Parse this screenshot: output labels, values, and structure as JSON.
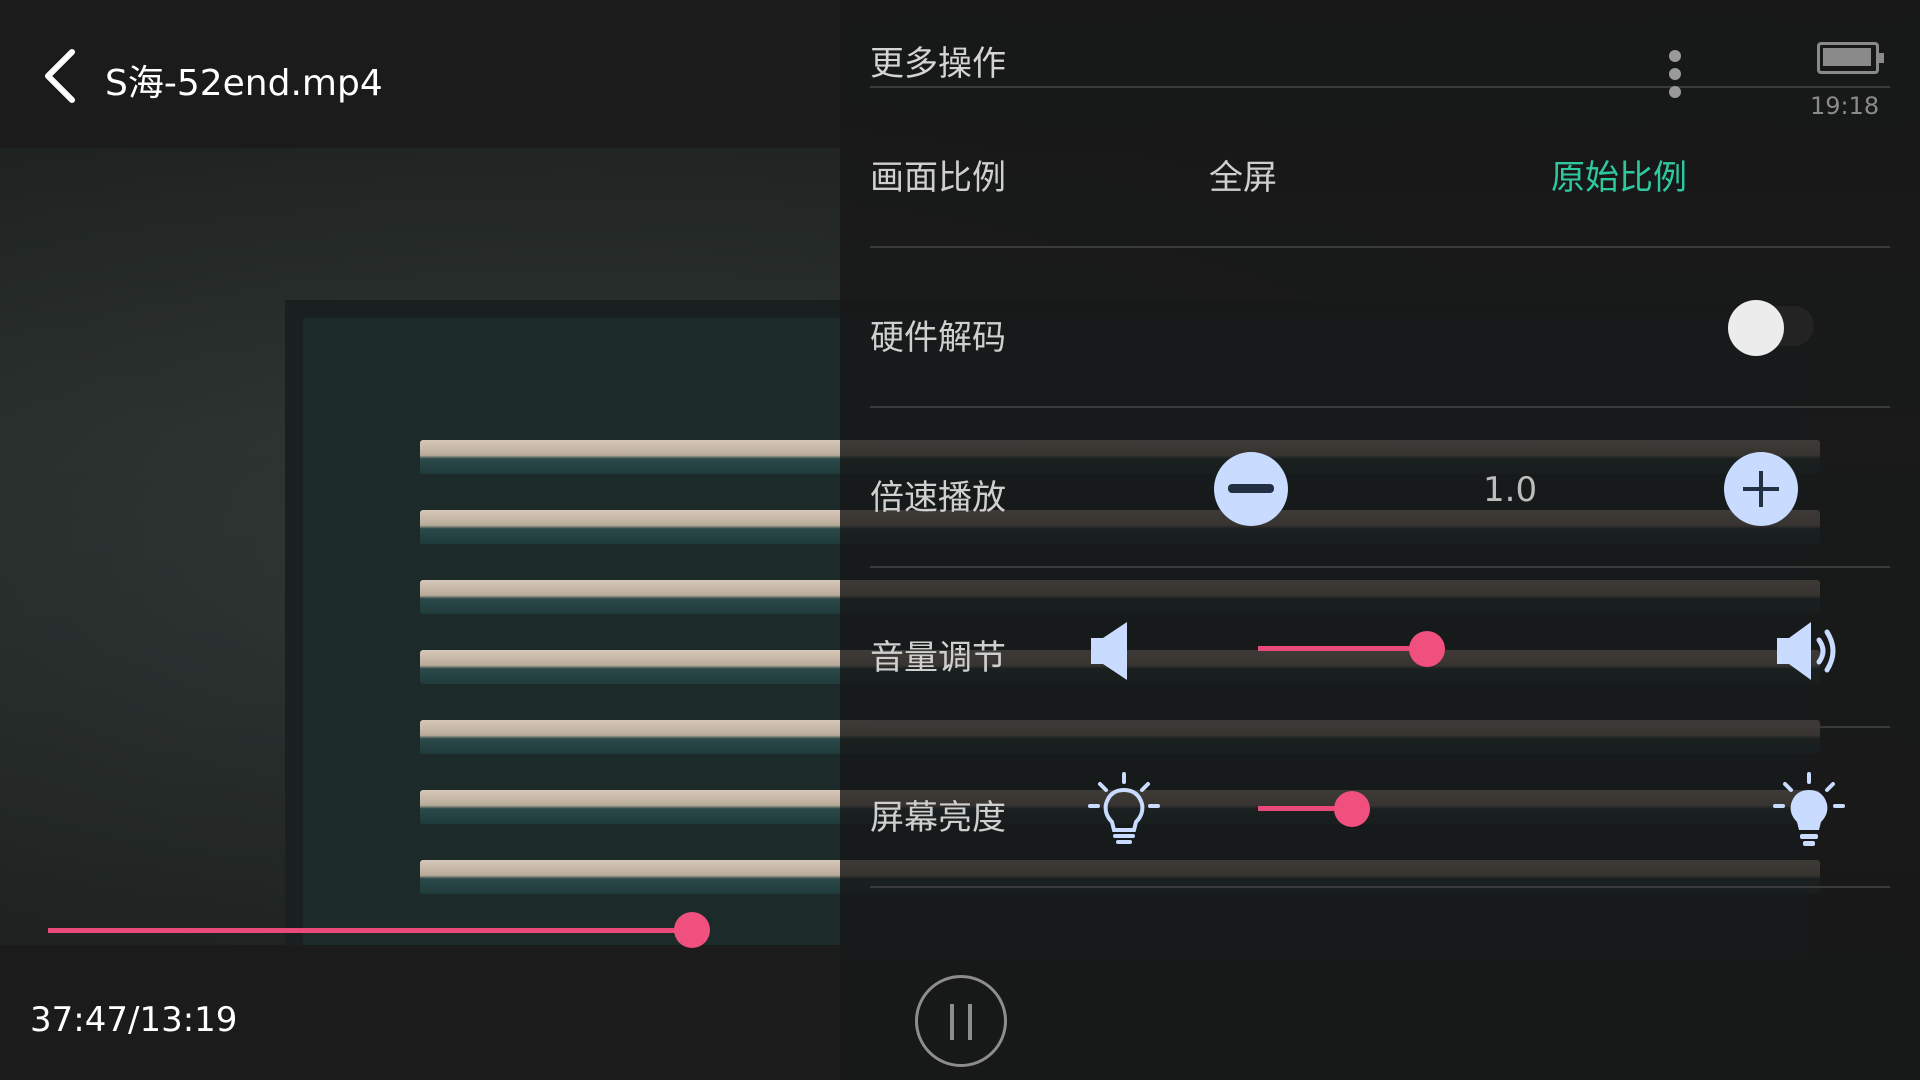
{
  "player": {
    "title": "S海-52end.mp4",
    "time": "37:47/13:19",
    "progress_fraction": 0.82,
    "state": "playing"
  },
  "panel": {
    "title": "更多操作",
    "clock": "19:18",
    "aspect": {
      "label": "画面比例",
      "options": [
        "全屏",
        "原始比例"
      ],
      "selected": "原始比例"
    },
    "hw_decode": {
      "label": "硬件解码",
      "enabled": false
    },
    "speed": {
      "label": "倍速播放",
      "value": "1.0"
    },
    "volume": {
      "label": "音量调节",
      "level_fraction": 0.36
    },
    "brightness": {
      "label": "屏幕亮度",
      "level_fraction": 0.2
    }
  },
  "colors": {
    "accent": "#F0507E",
    "selected_option": "#2FC9A0",
    "icon_blue": "#C9DCFF"
  },
  "icons": [
    "back-arrow",
    "more-vertical",
    "battery",
    "minus-circle",
    "plus-circle",
    "volume-low",
    "volume-high",
    "bulb-dim",
    "bulb-bright",
    "pause"
  ]
}
